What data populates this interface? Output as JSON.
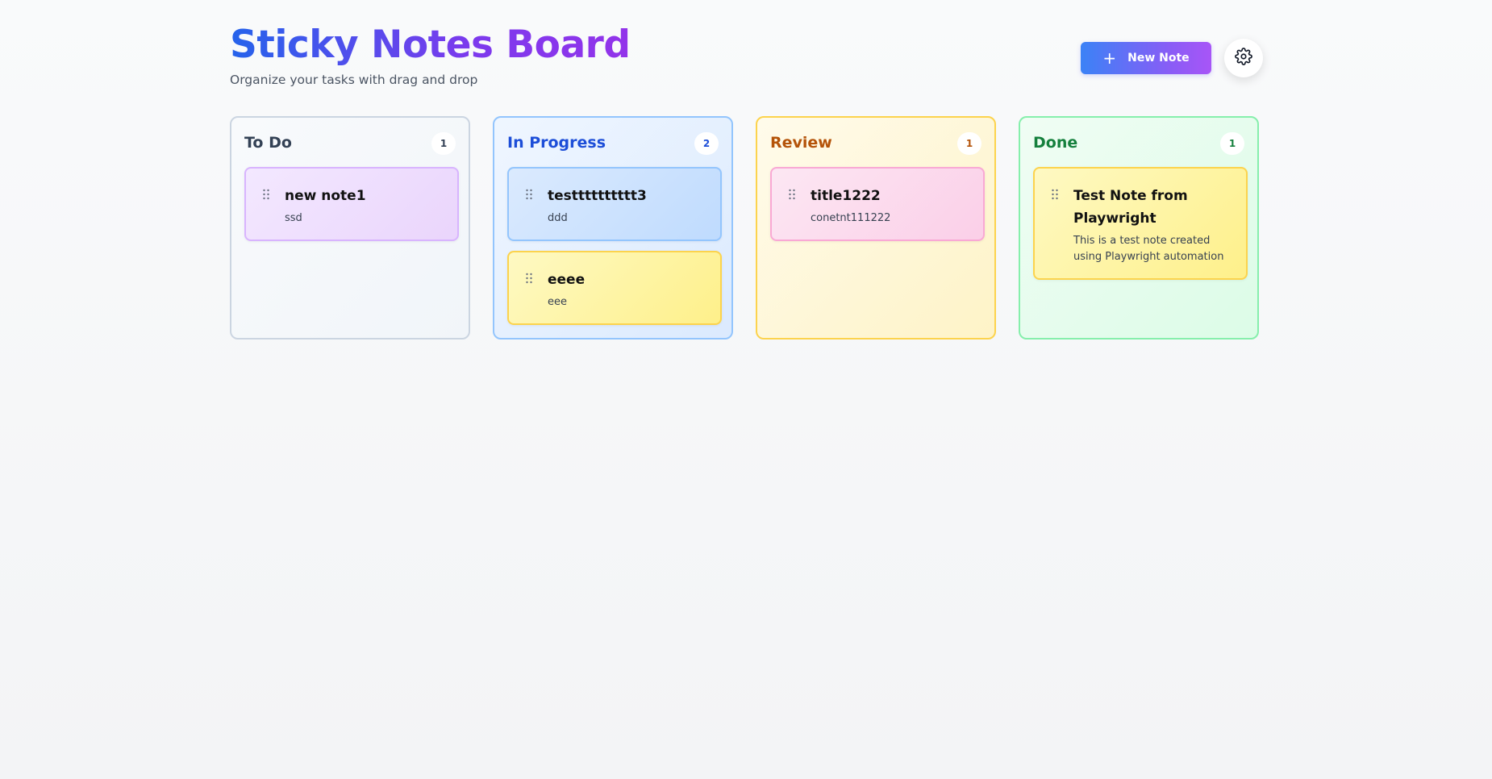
{
  "header": {
    "title": "Sticky Notes Board",
    "subtitle": "Organize your tasks with drag and drop",
    "new_note_label": "New Note",
    "accent_gradient": [
      "#2563eb",
      "#9333ea"
    ]
  },
  "columns": [
    {
      "title": "To Do",
      "count": "1",
      "color": "#334155",
      "notes": [
        {
          "title": "new note1",
          "content": "ssd",
          "color": "purple"
        }
      ]
    },
    {
      "title": "In Progress",
      "count": "2",
      "color": "#1d4ed8",
      "notes": [
        {
          "title": "testttttttttt3",
          "content": "ddd",
          "color": "blue"
        },
        {
          "title": "eeee",
          "content": "eee",
          "color": "yellow"
        }
      ]
    },
    {
      "title": "Review",
      "count": "1",
      "color": "#b45309",
      "notes": [
        {
          "title": "title1222",
          "content": "conetnt111222",
          "color": "pink"
        }
      ]
    },
    {
      "title": "Done",
      "count": "1",
      "color": "#15803d",
      "notes": [
        {
          "title": "Test Note from Playwright",
          "content": "This is a test note created using Playwright automation",
          "color": "yellow"
        }
      ]
    }
  ],
  "icons": {
    "new_note": "plus-icon",
    "settings": "gear-icon",
    "note_handle": "drag-handle-icon"
  }
}
